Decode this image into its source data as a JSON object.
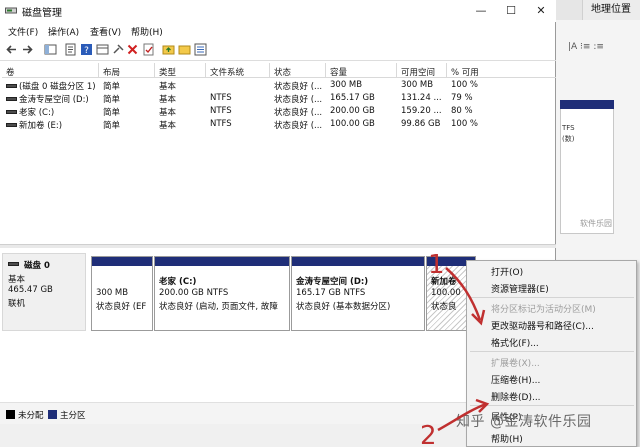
{
  "background_app": {
    "tab_label": "地理位置",
    "toolbar_text": "|A  ⁝≡  :≡"
  },
  "window": {
    "title": "磁盘管理",
    "minimize": "—",
    "maximize": "☐",
    "close": "✕"
  },
  "menu": [
    "文件(F)",
    "操作(A)",
    "查看(V)",
    "帮助(H)"
  ],
  "table": {
    "columns": [
      "卷",
      "布局",
      "类型",
      "文件系统",
      "状态",
      "容量",
      "可用空间",
      "% 可用"
    ],
    "rows": [
      {
        "volume": "(磁盘 0 磁盘分区 1)",
        "layout": "简单",
        "type": "基本",
        "fs": "",
        "status": "状态良好 (...",
        "capacity": "300 MB",
        "free": "300 MB",
        "pct": "100 %"
      },
      {
        "volume": "金涛专屋空间 (D:)",
        "layout": "简单",
        "type": "基本",
        "fs": "NTFS",
        "status": "状态良好 (...",
        "capacity": "165.17 GB",
        "free": "131.24 ...",
        "pct": "79 %"
      },
      {
        "volume": "老家 (C:)",
        "layout": "简单",
        "type": "基本",
        "fs": "NTFS",
        "status": "状态良好 (...",
        "capacity": "200.00 GB",
        "free": "159.20 ...",
        "pct": "80 %"
      },
      {
        "volume": "新加卷 (E:)",
        "layout": "简单",
        "type": "基本",
        "fs": "NTFS",
        "status": "状态良好 (...",
        "capacity": "100.00 GB",
        "free": "99.86 GB",
        "pct": "100 %"
      }
    ]
  },
  "disk": {
    "name": "磁盘 0",
    "type": "基本",
    "size": "465.47 GB",
    "state": "联机",
    "partitions": [
      {
        "title": "",
        "size": "300 MB",
        "status": "状态良好 (EF"
      },
      {
        "title": "老家  (C:)",
        "size": "200.00 GB NTFS",
        "status": "状态良好 (启动, 页面文件, 故障"
      },
      {
        "title": "金涛专屋空间  (D:)",
        "size": "165.17 GB NTFS",
        "status": "状态良好 (基本数据分区)"
      },
      {
        "title": "新加卷",
        "size": "100.00",
        "status": "状态良"
      }
    ]
  },
  "legend": {
    "unallocated": "未分配",
    "primary": "主分区"
  },
  "context_menu": {
    "items": [
      {
        "label": "打开(O)",
        "enabled": true
      },
      {
        "label": "资源管理器(E)",
        "enabled": true
      },
      {
        "label": "将分区标记为活动分区(M)",
        "enabled": false
      },
      {
        "label": "更改驱动器号和路径(C)...",
        "enabled": true
      },
      {
        "label": "格式化(F)...",
        "enabled": true
      },
      {
        "label": "扩展卷(X)...",
        "enabled": false
      },
      {
        "label": "压缩卷(H)...",
        "enabled": true
      },
      {
        "label": "删除卷(D)...",
        "enabled": true
      },
      {
        "label": "属性(P)",
        "enabled": true
      },
      {
        "label": "帮助(H)",
        "enabled": true
      }
    ]
  },
  "annotations": {
    "step1": "1",
    "step2": "2"
  },
  "watermark": "知乎 @金涛软件乐园",
  "colors": {
    "primary_partition": "#1f2e78",
    "unallocated": "#000000",
    "annotation": "#c03030"
  }
}
